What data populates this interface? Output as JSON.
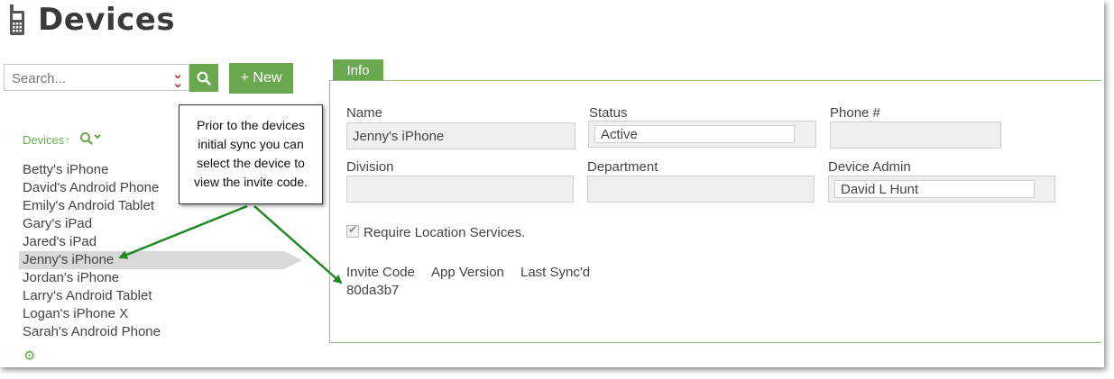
{
  "page": {
    "title": "Devices"
  },
  "search": {
    "placeholder": "Search...",
    "new_label": "+ New"
  },
  "list": {
    "header": "Devices",
    "sort_indicator": "↑",
    "items": [
      "Betty's iPhone",
      "David's Android Phone",
      "Emily's Android Tablet",
      "Gary's iPad",
      "Jared's iPad",
      "Jenny's iPhone",
      "Jordan's iPhone",
      "Larry's Android Tablet",
      "Logan's iPhone X",
      "Sarah's Android Phone"
    ],
    "selected": "Jenny's iPhone"
  },
  "tab": {
    "label": "Info"
  },
  "form": {
    "name_label": "Name",
    "name_value": "Jenny's iPhone",
    "status_label": "Status",
    "status_value": "Active",
    "phone_label": "Phone #",
    "phone_value": "",
    "division_label": "Division",
    "division_value": "",
    "department_label": "Department",
    "department_value": "",
    "admin_label": "Device Admin",
    "admin_value": "David L Hunt",
    "require_location_label": "Require Location Services.",
    "require_location_checked": true,
    "invite_code_label": "Invite Code",
    "app_version_label": "App Version",
    "last_sync_label": "Last Sync'd",
    "invite_code_value": "80da3b7"
  },
  "callout": {
    "lines": [
      "Prior to the devices",
      "initial sync you can",
      "select the device to",
      "view the invite code."
    ]
  },
  "colors": {
    "accent": "#6aa84f",
    "arrow": "#1f8a1f",
    "danger": "#c0392b"
  },
  "icons": [
    "phone-icon",
    "chevron-down-double-icon",
    "search-icon",
    "magnifier-dropdown-icon",
    "gear-icon",
    "checkbox-icon"
  ]
}
